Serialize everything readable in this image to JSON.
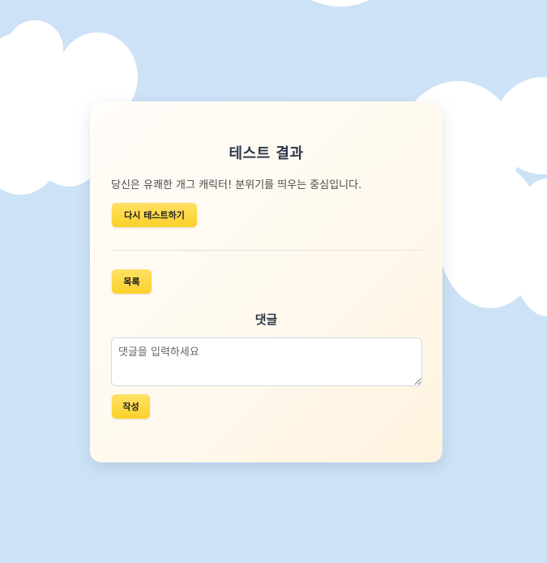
{
  "result": {
    "title": "테스트 결과",
    "description": "당신은 유쾌한 개그 캐릭터! 분위기를 띄우는 중심입니다.",
    "retry_label": "다시 테스트하기"
  },
  "nav": {
    "list_label": "목록"
  },
  "comments": {
    "heading": "댓글",
    "placeholder": "댓글을 입력하세요",
    "value": "",
    "submit_label": "작성"
  },
  "colors": {
    "background": "#cde2f6",
    "button": "#fcd12a",
    "card": "#fff9ee"
  }
}
